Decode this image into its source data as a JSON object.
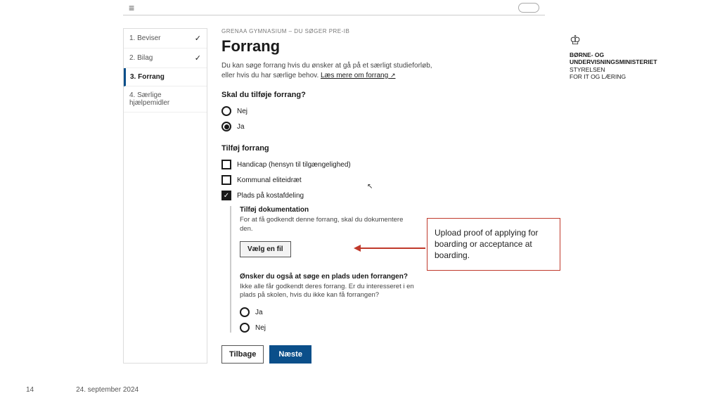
{
  "sidebar": {
    "items": [
      {
        "label": "1. Beviser",
        "done": true
      },
      {
        "label": "2. Bilag",
        "done": true
      },
      {
        "label": "3. Forrang",
        "active": true
      },
      {
        "label": "4. Særlige hjælpemidler"
      }
    ]
  },
  "content": {
    "eyebrow": "GRENAA GYMNASIUM – DU SØGER PRE-IB",
    "title": "Forrang",
    "intro_1": "Du kan søge forrang hvis du ønsker at gå på et særligt studieforløb, eller hvis du har særlige behov. ",
    "intro_link": "Læs mere om forrang",
    "q1_title": "Skal du tilføje forrang?",
    "q1_opts": {
      "no": "Nej",
      "yes": "Ja"
    },
    "sub_title": "Tilføj forrang",
    "checks": {
      "handicap": "Handicap (hensyn til tilgængelighed)",
      "elite": "Kommunal eliteidræt",
      "kost": "Plads på kostafdeling"
    },
    "doc_title": "Tilføj dokumentation",
    "doc_desc": "For at få godkendt denne forrang, skal du dokumentere den.",
    "file_btn": "Vælg en fil",
    "q2_title": "Ønsker du også at søge en plads uden forrangen?",
    "q2_desc": "Ikke alle får godkendt deres forrang. Er du interesseret i en plads på skolen, hvis du ikke kan få forrangen?",
    "q2_opts": {
      "yes": "Ja",
      "no": "Nej"
    },
    "nav": {
      "back": "Tilbage",
      "next": "Næste"
    }
  },
  "callout": "Upload proof of applying for boarding or acceptance at boarding.",
  "ministry": {
    "line1": "BØRNE- OG",
    "line2": "UNDERVISNINGSMINISTERIET",
    "line3": "STYRELSEN",
    "line4": "FOR IT OG LÆRING"
  },
  "footer": {
    "page": "14",
    "date": "24. september 2024"
  }
}
